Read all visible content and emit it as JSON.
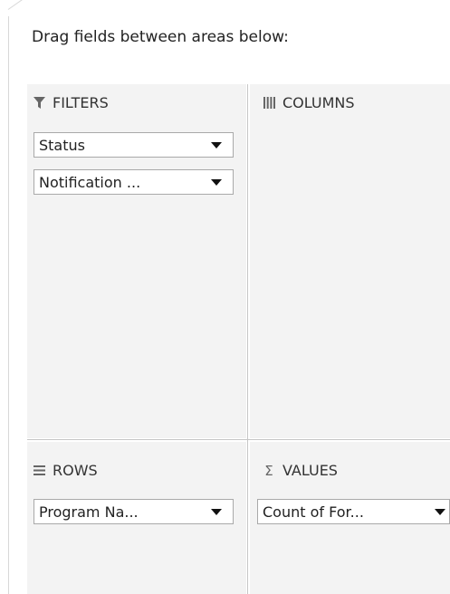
{
  "instruction": "Drag fields between areas below:",
  "areas": {
    "filters": {
      "title": "FILTERS",
      "icon": "filter-icon",
      "fields": [
        {
          "label": "Status"
        },
        {
          "label": "Notification ..."
        }
      ]
    },
    "columns": {
      "title": "COLUMNS",
      "icon": "columns-icon",
      "fields": []
    },
    "rows": {
      "title": "ROWS",
      "icon": "rows-icon",
      "fields": [
        {
          "label": "Program Na..."
        }
      ]
    },
    "values": {
      "title": "VALUES",
      "icon": "sigma-icon",
      "icon_glyph": "Σ",
      "fields": [
        {
          "label": "Count of For..."
        }
      ]
    }
  },
  "colors": {
    "area_background": "#f3f3f3",
    "divider": "#c6c6c6",
    "pill_border": "#a9a9a9",
    "icon": "#666666"
  }
}
